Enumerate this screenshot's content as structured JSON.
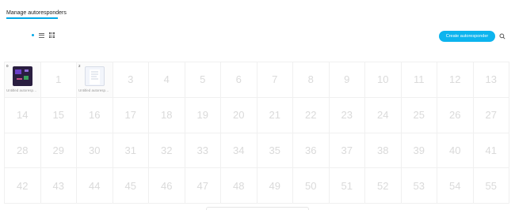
{
  "header": {
    "tab_label": "Manage autoresponders"
  },
  "toolbar": {
    "create_label": "Create autoresponder",
    "view_list_icon": "list-view-icon",
    "view_grid_icon": "grid-view-icon",
    "search_icon": "search-icon"
  },
  "colors": {
    "accent": "#00a8e8",
    "button": "#0db4ee",
    "placeholder_number": "#dadada"
  },
  "grid": {
    "filled": [
      {
        "index": "0",
        "label": "Untitled autoresponder",
        "thumb": "dark"
      },
      {
        "index": "2",
        "label": "Untitled autoresponder",
        "thumb": "light"
      }
    ],
    "placeholders": [
      "1",
      "3",
      "4",
      "5",
      "6",
      "7",
      "8",
      "9",
      "10",
      "11",
      "12",
      "13",
      "14",
      "15",
      "16",
      "17",
      "18",
      "19",
      "20",
      "21",
      "22",
      "23",
      "24",
      "25",
      "26",
      "27",
      "28",
      "29",
      "30",
      "31",
      "32",
      "33",
      "34",
      "35",
      "36",
      "37",
      "38",
      "39",
      "40",
      "41",
      "42",
      "43",
      "44",
      "45",
      "46",
      "47",
      "48",
      "49",
      "50",
      "51",
      "52",
      "53",
      "54",
      "55"
    ]
  }
}
